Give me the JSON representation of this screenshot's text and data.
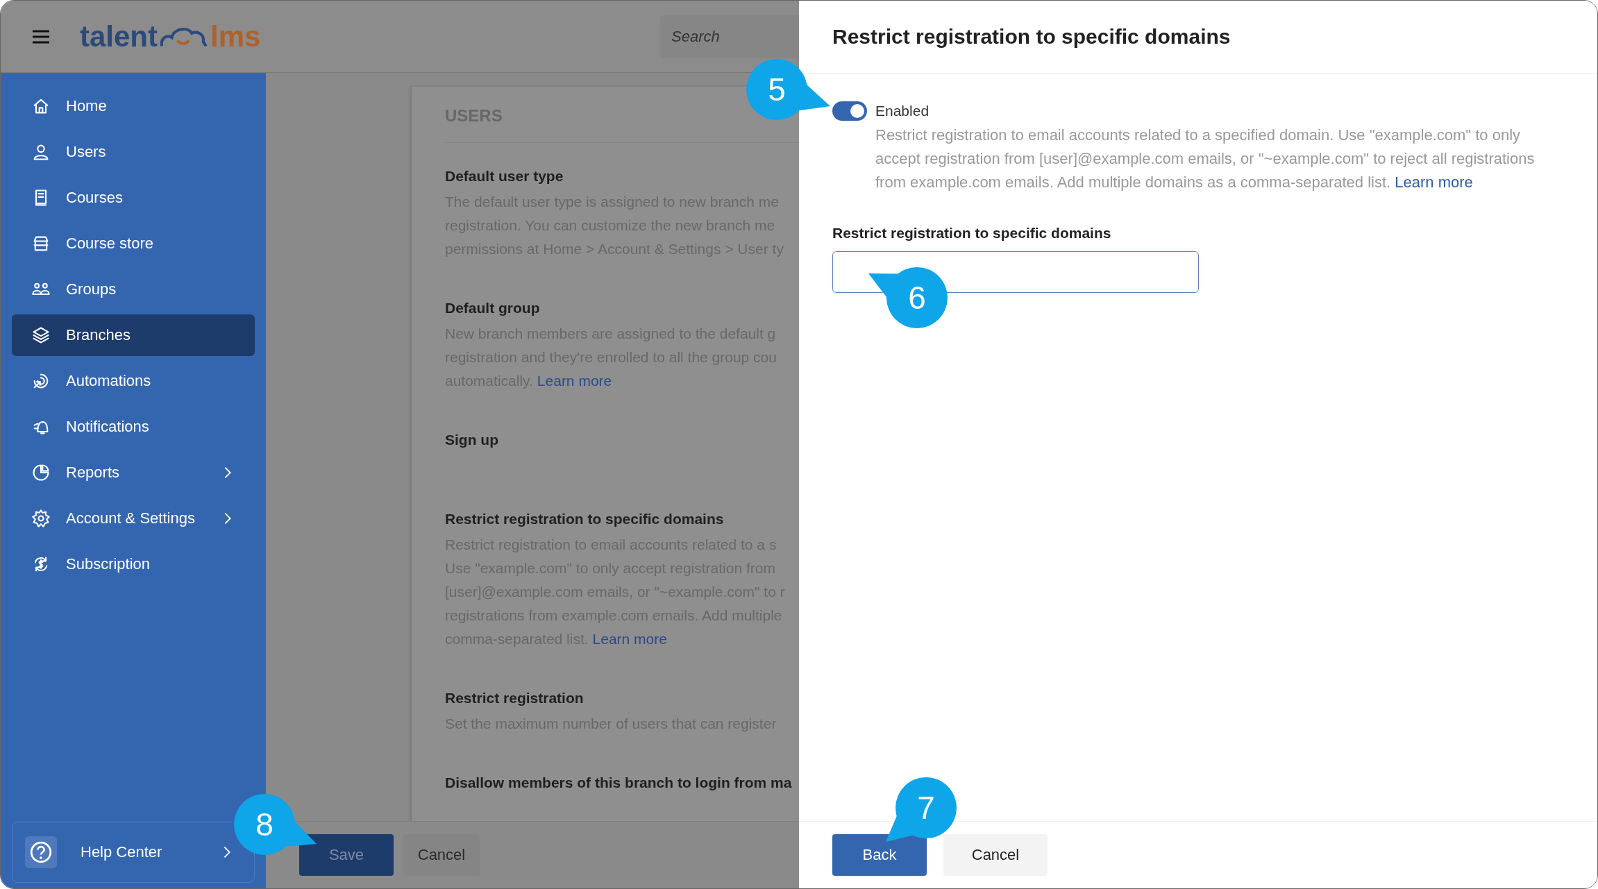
{
  "header": {
    "logo": {
      "part1": "talent",
      "part2": "lms"
    },
    "search": {
      "placeholder": "Search"
    }
  },
  "sidebar": {
    "items": [
      {
        "label": "Home",
        "selected": false,
        "submenu": false
      },
      {
        "label": "Users",
        "selected": false,
        "submenu": false
      },
      {
        "label": "Courses",
        "selected": false,
        "submenu": false
      },
      {
        "label": "Course store",
        "selected": false,
        "submenu": false
      },
      {
        "label": "Groups",
        "selected": false,
        "submenu": false
      },
      {
        "label": "Branches",
        "selected": true,
        "submenu": false
      },
      {
        "label": "Automations",
        "selected": false,
        "submenu": false
      },
      {
        "label": "Notifications",
        "selected": false,
        "submenu": false
      },
      {
        "label": "Reports",
        "selected": false,
        "submenu": true
      },
      {
        "label": "Account & Settings",
        "selected": false,
        "submenu": true
      },
      {
        "label": "Subscription",
        "selected": false,
        "submenu": false
      }
    ],
    "help": {
      "label": "Help Center"
    }
  },
  "settings_card": {
    "title": "USERS",
    "sections": [
      {
        "heading": "Default user type",
        "lines": [
          "The default user type is assigned to new branch me",
          "registration. You can customize the new branch me",
          "permissions at Home > Account & Settings > User ty"
        ]
      },
      {
        "heading": "Default group",
        "lines": [
          "New branch members are assigned to the default g",
          "registration and they're enrolled to all the group cou",
          "automatically."
        ],
        "link": "Learn more"
      },
      {
        "heading": "Sign up"
      },
      {
        "heading": "Restrict registration to specific domains",
        "lines": [
          "Restrict registration to email accounts related to a s",
          "Use \"example.com\" to only accept registration from",
          "[user]@example.com emails, or \"~example.com\" to r",
          "registrations from example.com emails. Add multiple",
          "comma-separated list."
        ],
        "link": "Learn more"
      },
      {
        "heading": "Restrict registration",
        "lines": [
          "Set the maximum number of users that can register"
        ]
      },
      {
        "heading": "Disallow members of this branch to login from ma"
      }
    ]
  },
  "page_footer": {
    "buttons": [
      {
        "label": "Save",
        "kind": "primary"
      },
      {
        "label": "Cancel",
        "kind": "secondary"
      }
    ]
  },
  "drawer": {
    "title": "Restrict registration to specific domains",
    "toggle": {
      "label": "Enabled",
      "on": true
    },
    "description": "Restrict registration to email accounts related to a specified domain. Use \"example.com\" to only accept registration from [user]@example.com emails, or \"~example.com\" to reject all registrations from example.com emails. Add multiple domains as a comma-separated list.",
    "link": "Learn more",
    "field": {
      "label": "Restrict registration to specific domains"
    },
    "buttons": [
      {
        "label": "Back",
        "kind": "primary"
      },
      {
        "label": "Cancel",
        "kind": "secondary"
      }
    ]
  },
  "callouts": [
    {
      "label": "5"
    },
    {
      "label": "6"
    },
    {
      "label": "7"
    },
    {
      "label": "8"
    }
  ]
}
